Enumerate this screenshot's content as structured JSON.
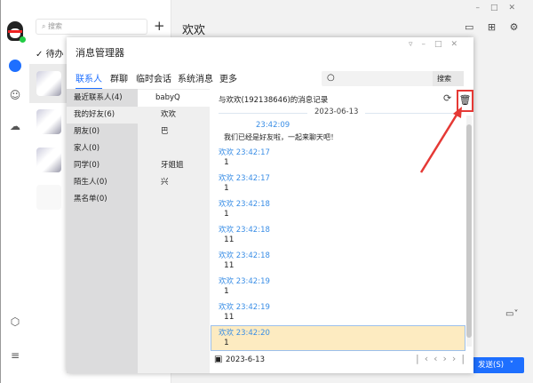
{
  "main_window": {
    "search_placeholder": "搜索",
    "add": "+",
    "todo": "待办",
    "chat_title": "欢欢",
    "send_label": "发送(S)"
  },
  "dialog": {
    "title": "消息管理器",
    "tabs": [
      {
        "label": "联系人",
        "active": true
      },
      {
        "label": "群聊"
      },
      {
        "label": "临时会话"
      },
      {
        "label": "系统消息"
      },
      {
        "label": "更多"
      }
    ],
    "search_button": "搜索",
    "categories": [
      "最近联系人(4)",
      "我的好友(6)",
      "朋友(0)",
      "家人(0)",
      "同学(0)",
      "陌生人(0)",
      "黑名单(0)"
    ],
    "friends": [
      "babyQ",
      "欢欢",
      "巴",
      "",
      "牙姐姐",
      "兴"
    ],
    "record_title": "与欢欢(192138646)的消息记录",
    "date_divider": "2023-06-13",
    "messages": [
      {
        "sender": "",
        "time": "23:42:09",
        "text": "我们已经是好友啦，一起来聊天吧！"
      },
      {
        "sender": "欢欢",
        "time": "23:42:17",
        "text": "1"
      },
      {
        "sender": "欢欢",
        "time": "23:42:17",
        "text": "1"
      },
      {
        "sender": "欢欢",
        "time": "23:42:18",
        "text": "1"
      },
      {
        "sender": "欢欢",
        "time": "23:42:18",
        "text": "11"
      },
      {
        "sender": "欢欢",
        "time": "23:42:18",
        "text": "11"
      },
      {
        "sender": "欢欢",
        "time": "23:42:19",
        "text": "1"
      },
      {
        "sender": "欢欢",
        "time": "23:42:19",
        "text": "11"
      },
      {
        "sender": "欢欢",
        "time": "23:42:20",
        "text": "1",
        "selected": true
      }
    ],
    "footer_date": "2023-6-13"
  },
  "colors": {
    "accent": "#1e6fff",
    "link": "#3a8ee6",
    "highlight": "#fdebc1",
    "annotation": "#e53935"
  }
}
